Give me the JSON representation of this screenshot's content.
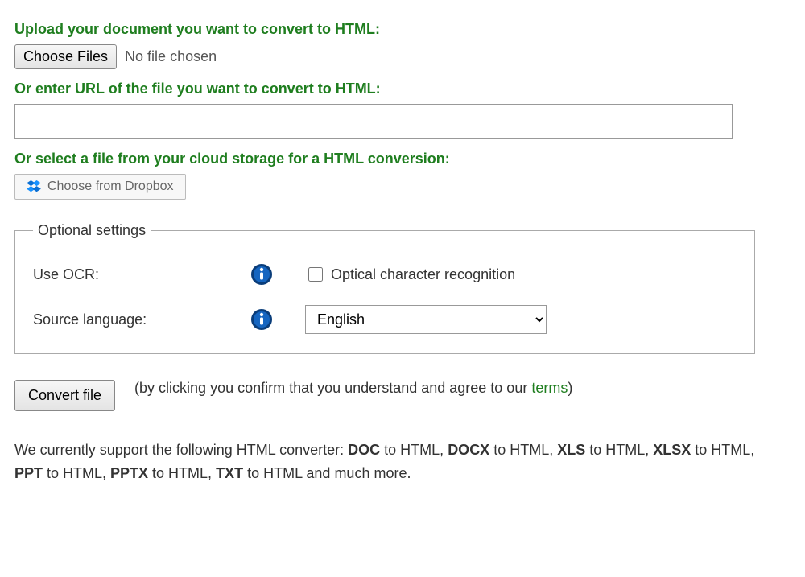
{
  "upload": {
    "heading": "Upload your document you want to convert to HTML:",
    "choose_btn": "Choose Files",
    "no_file": "No file chosen"
  },
  "url": {
    "heading": "Or enter URL of the file you want to convert to HTML:",
    "value": ""
  },
  "cloud": {
    "heading": "Or select a file from your cloud storage for a HTML conversion:",
    "dropbox_btn": "Choose from Dropbox"
  },
  "optional": {
    "legend": "Optional settings",
    "ocr_label": "Use OCR:",
    "ocr_desc": "Optical character recognition",
    "lang_label": "Source language:",
    "lang_value": "English"
  },
  "convert": {
    "btn": "Convert file",
    "note_prefix": "(by clicking you confirm that you understand and agree to our ",
    "terms": "terms",
    "note_suffix": ")"
  },
  "support": {
    "prefix": "We currently support the following HTML converter: ",
    "f1": "DOC",
    "t1": " to HTML, ",
    "f2": "DOCX",
    "t2": " to HTML, ",
    "f3": "XLS",
    "t3": " to HTML, ",
    "f4": "XLSX",
    "t4": " to HTML, ",
    "f5": "PPT",
    "t5": " to HTML, ",
    "f6": "PPTX",
    "t6": " to HTML, ",
    "f7": "TXT",
    "t7": " to HTML and much more."
  }
}
